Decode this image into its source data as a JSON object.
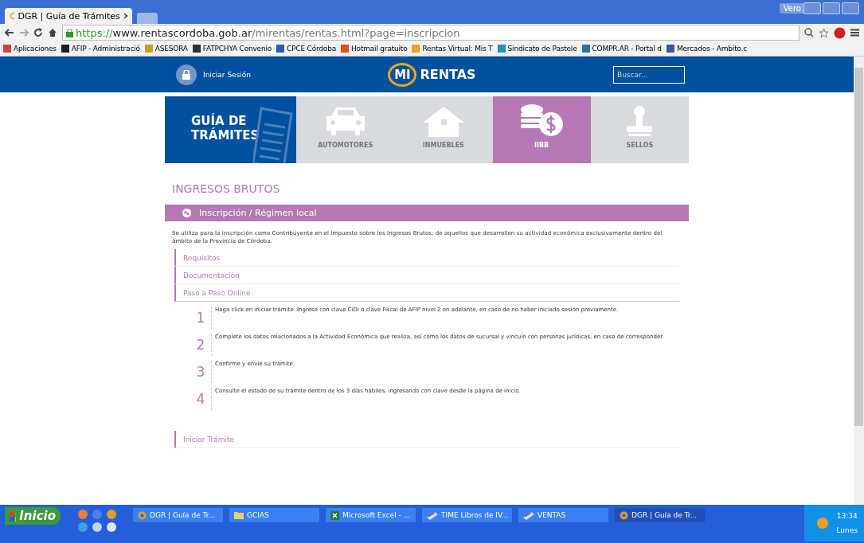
{
  "browser": {
    "tabs": [
      {
        "title": "DGR | Guía de Trámites",
        "selected": true
      }
    ],
    "user": "Vero",
    "url": {
      "scheme": "https://",
      "host": "www.rentascordoba.gob.ar",
      "path": "/mirentas/rentas.html?page=inscripcion"
    },
    "bookmarks": [
      {
        "label": "Aplicaciones",
        "color": "#d04040"
      },
      {
        "label": "AFIP - Administració",
        "color": "#202020"
      },
      {
        "label": "ASESORA",
        "color": "#c8a020"
      },
      {
        "label": "FATPCHYA Convenio",
        "color": "#303030"
      },
      {
        "label": "CPCE Córdoba",
        "color": "#2a5caa"
      },
      {
        "label": "Hotmail gratuito",
        "color": "#e05020"
      },
      {
        "label": "Rentas Virtual: Mis T",
        "color": "#f0a020"
      },
      {
        "label": "Sindicato de Pastele",
        "color": "#2090c0"
      },
      {
        "label": "COMPR.AR - Portal d",
        "color": "#3070b0"
      },
      {
        "label": "Mercados - Ambito.c",
        "color": "#3a5a9a"
      }
    ]
  },
  "header": {
    "login": "Iniciar Sesión",
    "logo": {
      "mi": "MI",
      "rentas": "RENTAS"
    },
    "search": {
      "placeholder": "Buscar..."
    }
  },
  "guide": {
    "line1": "GUÍA DE",
    "line2": "TRÁMITES"
  },
  "categories": [
    {
      "label": "AUTOMOTORES",
      "kind": "car",
      "selected": false
    },
    {
      "label": "INMUEBLES",
      "kind": "house",
      "selected": false
    },
    {
      "label": "IIBB",
      "kind": "coins",
      "selected": true
    },
    {
      "label": "SELLOS",
      "kind": "stamp",
      "selected": false
    }
  ],
  "section_title": "INGRESOS BRUTOS",
  "panel_title": "Inscripción / Régimen local",
  "description": "Se utiliza para la inscripción como Contribuyente en el Impuesto sobre los Ingresos Brutos, de aquellos que desarrollen su actividad económica exclusivamente dentro del ámbito de la Provincia de Córdoba.",
  "links": [
    {
      "label": "Requisitos",
      "expanded": false
    },
    {
      "label": "Documentación",
      "expanded": false
    },
    {
      "label": "Paso a Paso Online",
      "expanded": true
    }
  ],
  "steps": [
    {
      "number": "1",
      "text": "Haga click en iniciar trámite. Ingrese con clave CiDi o clave Fiscal de AFIP nivel 2 en adelante, en caso de no haber iniciado sesión previamente."
    },
    {
      "number": "2",
      "text": "Complete los datos relacionados a la Actividad Económica que realiza, así como los datos de sucursal y vínculo con personas jurídicas, en caso de corresponder."
    },
    {
      "number": "3",
      "text": "Confirme y envíe su trámite."
    },
    {
      "number": "4",
      "text": "Consulte el estado de su trámite dentro de los 3 días hábiles, ingresando con clave desde la página de inicio."
    }
  ],
  "action_link": "Iniciar Trámite",
  "taskbar": {
    "start": "Inicio",
    "tasks": [
      {
        "label": "DGR | Guía de Tr...",
        "kind": "chrome",
        "selected": false
      },
      {
        "label": "GCIAS",
        "kind": "folder",
        "selected": false
      },
      {
        "label": "Microsoft Excel - ...",
        "kind": "excel",
        "selected": false
      },
      {
        "label": "TIME Libros de IV...",
        "kind": "app",
        "selected": false
      },
      {
        "label": "VENTAS",
        "kind": "app",
        "selected": false
      },
      {
        "label": "DGR | Guía de Tr...",
        "kind": "chrome",
        "selected": true
      }
    ],
    "time": "13:34",
    "day": "Lunes"
  }
}
